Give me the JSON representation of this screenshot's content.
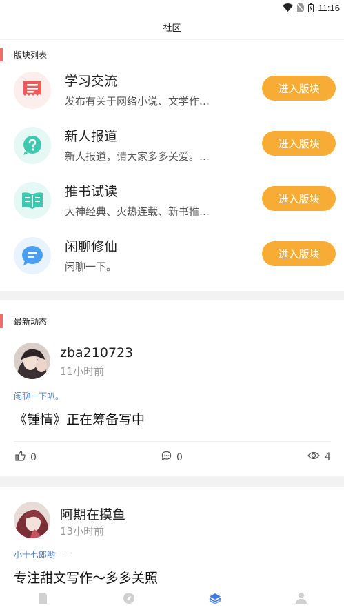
{
  "status_bar": {
    "time": "11:16"
  },
  "header": {
    "title": "社区"
  },
  "sections": {
    "title": "版块列表",
    "items": [
      {
        "name": "学习交流",
        "description": "发布有关于网络小说、文学作…",
        "button": "进入版块",
        "icon": "notebook-icon",
        "color": "#f05a5a"
      },
      {
        "name": "新人报道",
        "description": "新人报道，请大家多多关爱。…",
        "button": "进入版块",
        "icon": "question-icon",
        "color": "#3cc9b0"
      },
      {
        "name": "推书试读",
        "description": "大神经典、火热连载、新书推…",
        "button": "进入版块",
        "icon": "book-icon",
        "color": "#3cc9b0"
      },
      {
        "name": "闲聊修仙",
        "description": "闲聊一下。",
        "button": "进入版块",
        "icon": "chat-bubble-icon",
        "color": "#4a9ff0"
      }
    ]
  },
  "feed": {
    "title": "最新动态",
    "posts": [
      {
        "username": "zba210723",
        "time": "11小时前",
        "forum": "闲聊一下叭。",
        "title": "《锺情》正在筹备写中",
        "likes": "0",
        "comments": "0",
        "views": "4"
      },
      {
        "username": "阿期在摸鱼",
        "time": "13小时前",
        "forum": "小十七郎哟——",
        "title": "专注甜文写作～多多关照"
      }
    ]
  },
  "colors": {
    "accent": "#f7ac36",
    "section_bar": "#f26b6b",
    "link": "#4a7ec8",
    "tab_active": "#3d7be0"
  },
  "tab_bar": {
    "items": [
      "bookshelf-icon",
      "discover-icon",
      "community-icon",
      "profile-icon"
    ],
    "active": "community-icon"
  }
}
